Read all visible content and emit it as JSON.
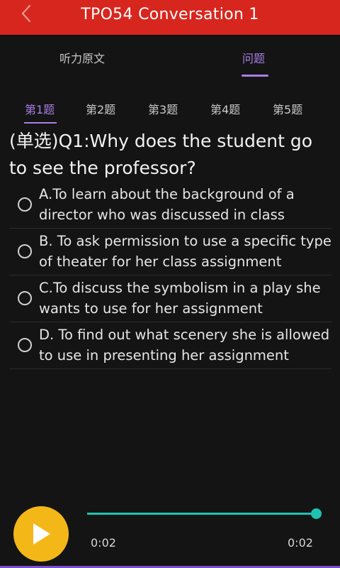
{
  "header": {
    "title": "TPO54 Conversation 1",
    "back_icon": "chevron-left-icon",
    "bg_color": "#d7261e"
  },
  "top_tabs": [
    {
      "label": "听力原文",
      "active": false
    },
    {
      "label": "问题",
      "active": true
    }
  ],
  "question_tabs": [
    {
      "label": "第1题",
      "active": true
    },
    {
      "label": "第2题",
      "active": false
    },
    {
      "label": "第3题",
      "active": false
    },
    {
      "label": "第4题",
      "active": false
    },
    {
      "label": "第5题",
      "active": false
    }
  ],
  "question": {
    "text": "(单选)Q1:Why does the student go to see the professor?"
  },
  "options": [
    {
      "text": "A.To learn about the background of a director who was discussed in class",
      "selected": false
    },
    {
      "text": "B. To ask permission to use a specific type of theater for her class assignment",
      "selected": false
    },
    {
      "text": "C.To discuss the symbolism in a play she wants to use for her assignment",
      "selected": false
    },
    {
      "text": "D. To find out what scenery she is allowed to use in presenting her assignment",
      "selected": false
    }
  ],
  "player": {
    "play_icon": "play-icon",
    "current_time": "0:02",
    "total_time": "0:02",
    "progress": 1.0,
    "accent_color": "#1ec2b0",
    "button_color": "#f3b718"
  },
  "colors": {
    "active_tab": "#a97ee6",
    "background": "#141414"
  }
}
